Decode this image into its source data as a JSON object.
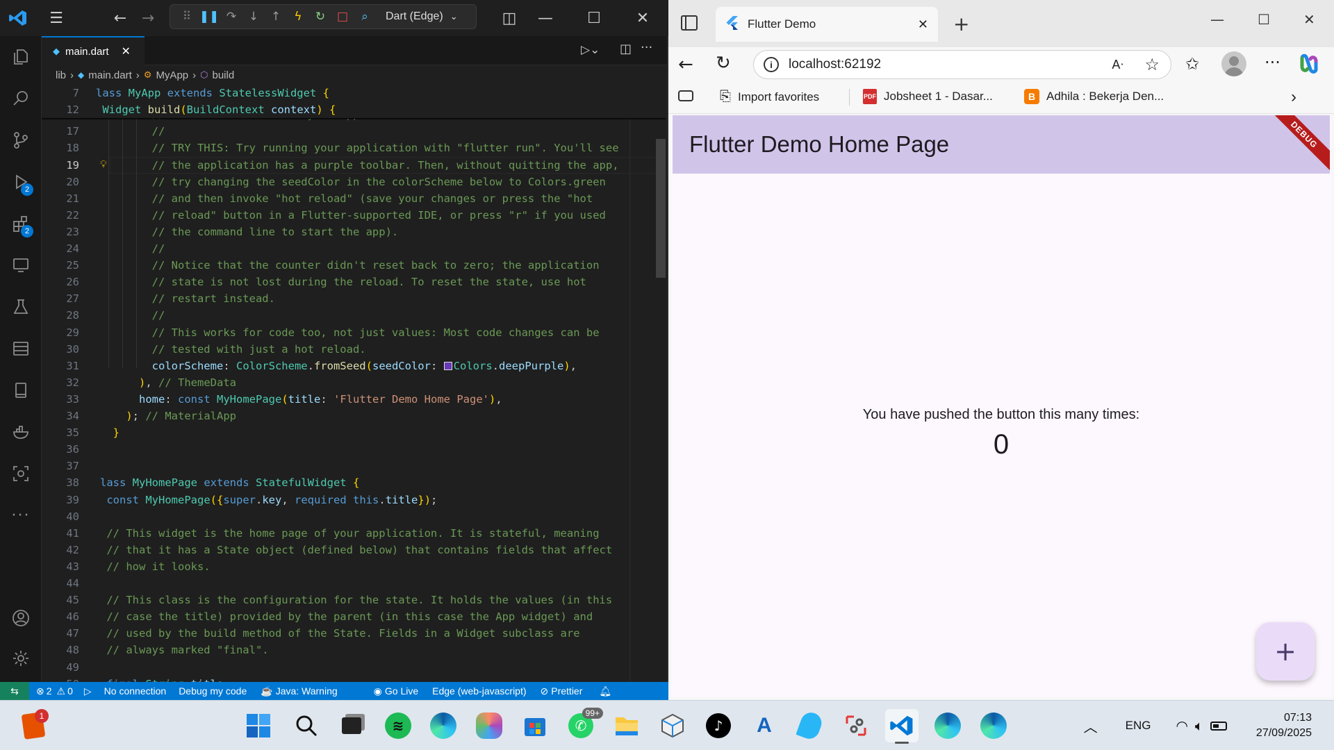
{
  "vscode": {
    "debug_target": "Dart (Edge)",
    "tab": "main.dart",
    "breadcrumb": [
      "lib",
      "main.dart",
      "MyApp",
      "build"
    ],
    "activity_badges": {
      "run_debug": "2",
      "extensions": "2"
    },
    "sticky": [
      {
        "num": "7",
        "tokens": [
          [
            "k",
            "lass "
          ],
          [
            "t",
            "MyApp "
          ],
          [
            "k",
            "extends "
          ],
          [
            "t",
            "StatelessWidget "
          ],
          [
            "y",
            "{"
          ]
        ]
      },
      {
        "num": "12",
        "tokens": [
          [
            "t",
            " Widget "
          ],
          [
            "f",
            "build"
          ],
          [
            "y",
            "("
          ],
          [
            "t",
            "BuildContext "
          ],
          [
            "v",
            "context"
          ],
          [
            "y",
            ") {"
          ]
        ]
      }
    ],
    "lines": [
      {
        "num": "16",
        "tokens": [
          [
            "c",
            "        // This is the theme of your application."
          ]
        ]
      },
      {
        "num": "17",
        "tokens": [
          [
            "c",
            "        //"
          ]
        ]
      },
      {
        "num": "18",
        "tokens": [
          [
            "c",
            "        // TRY THIS: Try running your application with \"flutter run\". You'll see"
          ]
        ]
      },
      {
        "num": "19",
        "tokens": [
          [
            "c",
            "        // the application has a purple toolbar. Then, without quitting the app,"
          ]
        ]
      },
      {
        "num": "20",
        "tokens": [
          [
            "c",
            "        // try changing the seedColor in the colorScheme below to Colors.green"
          ]
        ]
      },
      {
        "num": "21",
        "tokens": [
          [
            "c",
            "        // and then invoke \"hot reload\" (save your changes or press the \"hot"
          ]
        ]
      },
      {
        "num": "22",
        "tokens": [
          [
            "c",
            "        // reload\" button in a Flutter-supported IDE, or press \"r\" if you used"
          ]
        ]
      },
      {
        "num": "23",
        "tokens": [
          [
            "c",
            "        // the command line to start the app)."
          ]
        ]
      },
      {
        "num": "24",
        "tokens": [
          [
            "c",
            "        //"
          ]
        ]
      },
      {
        "num": "25",
        "tokens": [
          [
            "c",
            "        // Notice that the counter didn't reset back to zero; the application"
          ]
        ]
      },
      {
        "num": "26",
        "tokens": [
          [
            "c",
            "        // state is not lost during the reload. To reset the state, use hot"
          ]
        ]
      },
      {
        "num": "27",
        "tokens": [
          [
            "c",
            "        // restart instead."
          ]
        ]
      },
      {
        "num": "28",
        "tokens": [
          [
            "c",
            "        //"
          ]
        ]
      },
      {
        "num": "29",
        "tokens": [
          [
            "c",
            "        // This works for code too, not just values: Most code changes can be"
          ]
        ]
      },
      {
        "num": "30",
        "tokens": [
          [
            "c",
            "        // tested with just a hot reload."
          ]
        ]
      },
      {
        "num": "31",
        "tokens": [
          [
            "v",
            "        colorScheme"
          ],
          [
            "p",
            ": "
          ],
          [
            "t",
            "ColorScheme"
          ],
          [
            "p",
            "."
          ],
          [
            "f",
            "fromSeed"
          ],
          [
            "y",
            "("
          ],
          [
            "v",
            "seedColor"
          ],
          [
            "p",
            ": "
          ],
          [
            "sw",
            ""
          ],
          [
            "t",
            "Colors"
          ],
          [
            "p",
            "."
          ],
          [
            "v",
            "deepPurple"
          ],
          [
            "y",
            ")"
          ],
          [
            "p",
            ","
          ]
        ]
      },
      {
        "num": "32",
        "tokens": [
          [
            "y",
            "      )"
          ],
          [
            "p",
            ", "
          ],
          [
            "c",
            "// ThemeData"
          ]
        ]
      },
      {
        "num": "33",
        "tokens": [
          [
            "v",
            "      home"
          ],
          [
            "p",
            ": "
          ],
          [
            "k",
            "const "
          ],
          [
            "t",
            "MyHomePage"
          ],
          [
            "y",
            "("
          ],
          [
            "v",
            "title"
          ],
          [
            "p",
            ": "
          ],
          [
            "s",
            "'Flutter Demo Home Page'"
          ],
          [
            "y",
            ")"
          ],
          [
            "p",
            ","
          ]
        ]
      },
      {
        "num": "34",
        "tokens": [
          [
            "y",
            "    )"
          ],
          [
            "p",
            "; "
          ],
          [
            "c",
            "// MaterialApp"
          ]
        ]
      },
      {
        "num": "35",
        "tokens": [
          [
            "y",
            "  }"
          ]
        ]
      },
      {
        "num": "36",
        "tokens": []
      },
      {
        "num": "37",
        "tokens": []
      },
      {
        "num": "38",
        "tokens": [
          [
            "k",
            "lass "
          ],
          [
            "t",
            "MyHomePage "
          ],
          [
            "k",
            "extends "
          ],
          [
            "t",
            "StatefulWidget "
          ],
          [
            "y",
            "{"
          ]
        ]
      },
      {
        "num": "39",
        "tokens": [
          [
            "k",
            " const "
          ],
          [
            "t",
            "MyHomePage"
          ],
          [
            "y",
            "({"
          ],
          [
            "k",
            "super"
          ],
          [
            "p",
            "."
          ],
          [
            "v",
            "key"
          ],
          [
            "p",
            ", "
          ],
          [
            "k",
            "required "
          ],
          [
            "k",
            "this"
          ],
          [
            "p",
            "."
          ],
          [
            "v",
            "title"
          ],
          [
            "y",
            "})"
          ],
          [
            "p",
            ";"
          ]
        ]
      },
      {
        "num": "40",
        "tokens": []
      },
      {
        "num": "41",
        "tokens": [
          [
            "c",
            " // This widget is the home page of your application. It is stateful, meaning"
          ]
        ]
      },
      {
        "num": "42",
        "tokens": [
          [
            "c",
            " // that it has a State object (defined below) that contains fields that affect"
          ]
        ]
      },
      {
        "num": "43",
        "tokens": [
          [
            "c",
            " // how it looks."
          ]
        ]
      },
      {
        "num": "44",
        "tokens": []
      },
      {
        "num": "45",
        "tokens": [
          [
            "c",
            " // This class is the configuration for the state. It holds the values (in this"
          ]
        ]
      },
      {
        "num": "46",
        "tokens": [
          [
            "c",
            " // case the title) provided by the parent (in this case the App widget) and"
          ]
        ]
      },
      {
        "num": "47",
        "tokens": [
          [
            "c",
            " // used by the build method of the State. Fields in a Widget subclass are"
          ]
        ]
      },
      {
        "num": "48",
        "tokens": [
          [
            "c",
            " // always marked \"final\"."
          ]
        ]
      },
      {
        "num": "49",
        "tokens": []
      },
      {
        "num": "50",
        "tokens": [
          [
            "k",
            " final "
          ],
          [
            "t",
            "String "
          ],
          [
            "v",
            "title"
          ],
          [
            "p",
            ";"
          ]
        ]
      }
    ],
    "status": {
      "errors": "2",
      "warnings": "0",
      "connection": "No connection",
      "debug": "Debug my code",
      "java": "Java: Warning",
      "golive": "Go Live",
      "device": "Edge (web-javascript)",
      "prettier": "Prettier"
    }
  },
  "edge": {
    "tab_title": "Flutter Demo",
    "url": "localhost:62192",
    "favorites": [
      "Import favorites",
      "Jobsheet 1 - Dasar...",
      "Adhila : Bekerja Den..."
    ],
    "app_title": "Flutter Demo Home Page",
    "debug_ribbon": "DEBUG",
    "message": "You have pushed the button this many times:",
    "counter": "0",
    "fab": "+"
  },
  "taskbar": {
    "notif_badge": "1",
    "whatsapp_badge": "99+",
    "lang": "ENG",
    "time": "07:13",
    "date": "27/09/2025"
  },
  "colors": {
    "accent": "#0078d4",
    "appbar": "#d1c4e9",
    "page_bg": "#fdf7fe",
    "deep_purple": "#673ab7"
  }
}
